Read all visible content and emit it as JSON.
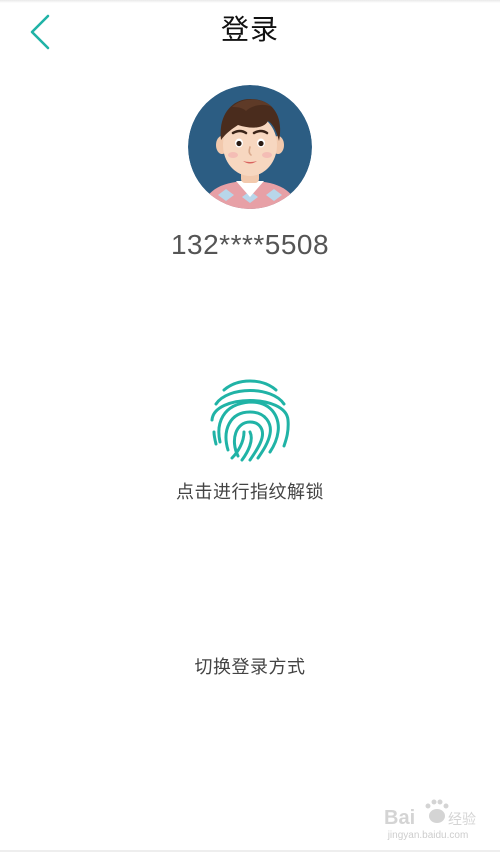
{
  "header": {
    "title": "登录",
    "back_icon": "chevron-left-icon",
    "accent_color": "#20b3a6"
  },
  "account": {
    "avatar": "avatar-cartoon-boy",
    "phone_masked": "132****5508"
  },
  "fingerprint": {
    "icon": "fingerprint-icon",
    "hint": "点击进行指纹解锁",
    "color": "#20b3a6"
  },
  "switch_login": {
    "label": "切换登录方式"
  },
  "watermark": {
    "text": "jingyan.baidu.com"
  }
}
